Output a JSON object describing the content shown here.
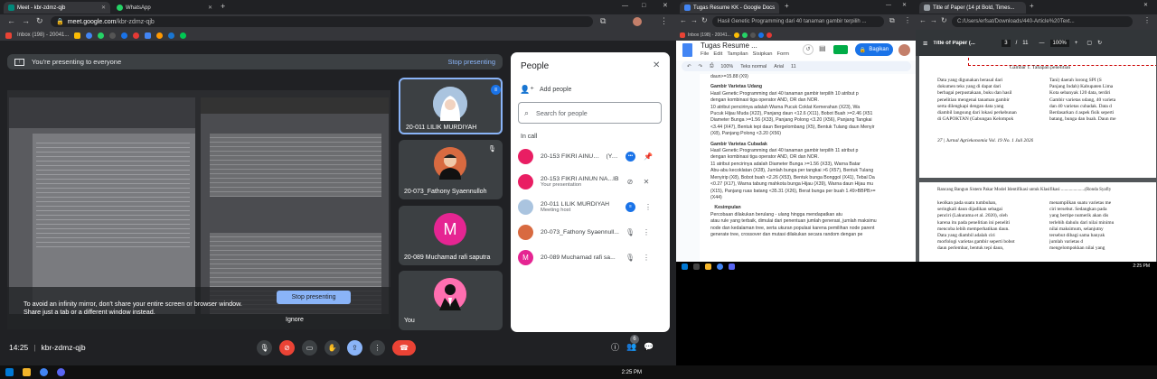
{
  "meet": {
    "tabs": [
      {
        "title": "Meet - kbr-zdmz-qjb"
      },
      {
        "title": "WhatsApp"
      }
    ],
    "url_host": "meet.google.com",
    "url_path": "/kbr-zdmz-qjb",
    "bookmark_inbox": "Inbox (198) - 20041...",
    "banner_text": "You're presenting to everyone",
    "stop_presenting": "Stop presenting",
    "mirror_warning_line1": "To avoid an infinity mirror, don't share your entire screen or browser window.",
    "mirror_warning_line2": "Share just a tab or a different window instead.",
    "mirror_stop_button": "Stop presenting",
    "mirror_ignore": "Ignore",
    "tiles": [
      {
        "name": "20-011 LILIK MURDIYAH"
      },
      {
        "name": "20-073_Fathony Syaennulloh"
      },
      {
        "name": "20-089 Muchamad rafi saputra",
        "initial": "M"
      },
      {
        "name": "You"
      }
    ],
    "meeting_time": "14:25",
    "meeting_code": "kbr-zdmz-qjb",
    "people_badge": "6",
    "people": {
      "title": "People",
      "add_people": "Add people",
      "search_placeholder": "Search for people",
      "in_call": "In call",
      "list": [
        {
          "name": "20-153 FIKRI AINUN ...",
          "tag": "(You)",
          "sub": ""
        },
        {
          "name": "20-153 FIKRI AINUN NA...IB",
          "tag": "",
          "sub": "Your presentation"
        },
        {
          "name": "20-011 LILIK MURDIYAH",
          "tag": "",
          "sub": "Meeting host"
        },
        {
          "name": "20-073_Fathony Syaennull...",
          "tag": "",
          "sub": ""
        },
        {
          "name": "20-089 Muchamad rafi sa...",
          "tag": "",
          "sub": ""
        }
      ],
      "initial_m": "M"
    }
  },
  "docs": {
    "tab_title": "Tugas Resume KK - Google Docs",
    "tab2": "Hasil Genetic Programming dari 40 tanaman gambir terpilih ...",
    "bookmark_inbox": "Inbox (198) - 20041...",
    "doc_title": "Tugas Resume ...",
    "menus": [
      "File",
      "Edit",
      "Tampilan",
      "Sisipkan",
      "Form"
    ],
    "share_label": "Bagikan",
    "zoom": "100%",
    "style": "Teks normal",
    "font": "Arial",
    "size": "11",
    "lines": [
      {
        "t": "daun>=15.88 (X9)",
        "c": "dt"
      },
      {
        "t": "Gambir Varietas Udang",
        "c": "dt dh"
      },
      {
        "t": "Hasil Genetic Programming dari 40 tanaman gambir terpilih 10 atribut p",
        "c": "dt"
      },
      {
        "t": "dengan kombinasi tiga operator AND, OR dan NOR.",
        "c": "dt"
      },
      {
        "t": "10 atribut pencirinya adalah Warna Pucuk Coklat Kemerahan (X23), Wa",
        "c": "dt"
      },
      {
        "t": "Pucuk Hijau Muda (X22), Panjang daun <12.6 (X11), Bobot Buah >=2.46 (X51",
        "c": "dt"
      },
      {
        "t": "Diameter Bunga >=1.56 (X33), Panjang Polong <3.20 (X56), Panjang Tangkai",
        "c": "dt"
      },
      {
        "t": "<3.44 (X47), Bentuk tepi daun Bergelombang (X5), Bentuk Tulang daun Menyir",
        "c": "dt"
      },
      {
        "t": "(X8), Panjang Polong <3.20 (X56)",
        "c": "dt"
      },
      {
        "t": "Gambir Varietas Cubadak",
        "c": "dt dh"
      },
      {
        "t": "Hasil Genetic Programming dari 40 tanaman gambir terpilih 11 atribut p",
        "c": "dt"
      },
      {
        "t": "dengan kombinasi tiga operator AND, OR dan NOR.",
        "c": "dt"
      },
      {
        "t": "11 atribut pencirinya adalah Diameter Bunga >=1.56 (X33), Warna Batar",
        "c": "dt"
      },
      {
        "t": "Abu-abu kecoklatan (X28), Jumlah bunga per tangkai >6 (X57), Bentuk Tulang",
        "c": "dt"
      },
      {
        "t": "Menyirip (X8), Bobot buah <2.26 (X53), Bentuk bunga Bonggol (X41), Tebal Da",
        "c": "dt"
      },
      {
        "t": "<0.27 (X17), Warna tabung mahkota bunga Hijau (X39), Warna daun Hijau mu",
        "c": "dt"
      },
      {
        "t": "(X15), Panjang ruas batang <35.31 (X26), Berat bunga per buah 1.49>BBPB>=",
        "c": "dt"
      },
      {
        "t": "(X44)",
        "c": "dt"
      }
    ],
    "section_num": "5.",
    "section_title": "Kesimpulan",
    "concl": [
      "Percobaan dilakukan berulang - ulang hingga mendapatkan atu",
      "atau rule yang terbaik, dimulai dari penentuan jumlah generasi, jumlah maksimu",
      "node dan kedalaman tree, serta ukuran populasi karena pemilihan node parent",
      "generate tree, crossover dan mutasi dilakukan secara random dengan pe"
    ]
  },
  "pdf": {
    "tab_title": "Title of Paper (14 pt Bold, Times...",
    "url": "C:/Users/erfsat/Downloads/440-Article%20Text...",
    "toolbar_title": "Title of Paper (...",
    "page_num": "3",
    "page_total": "11",
    "zoom": "100%",
    "figure_caption": "Gambar 1. Tahapan penelitian",
    "left_col": [
      "Data yang digunakan berasal dari",
      "dokumen teks yang di dapat dari",
      "berbagai perpustakaan, buku dan hasil",
      "penelitian mengenai tanaman gambir",
      "serta dilengkapi dengan data yang",
      "diambil langsung dari lokasi perkebunan",
      "di GAPOKTAN (Gabungan Kelompok"
    ],
    "right_col": [
      "Tani) daerah lorong SPI (S",
      "Panjang Indah) Kabupaten Lima",
      "Kota sebanyak 120 data, terdiri",
      "Gambir varietas udang, 40 varieta",
      "dan 40 varietas cubadak. Data d",
      "Berdasarkan 4 aspek fisik seperti",
      "batang, bunga dan buah. Daun me"
    ],
    "footer": "37 | Jurnal Agriekonomia Vol. 19 No. 1 Juli 2020",
    "header2": "Rancang Bangun Sistem Pakar Model Identifikasi untuk Klasifikasi .....................(Ronda Syafly",
    "left_col2": [
      "keolkan pada suatu tumbuhan,",
      "seringkali daun dijadikan sebagai",
      "penciri (Lakurama et al. 2020), oleh",
      "karena itu pada penelitian ini peneliti",
      "mencoba lebih memperhatikan daun.",
      "Data yang diambil adalah ciri",
      "morfologi varietas gambir seperti bobot",
      "daun perlembar, bentuk tepi daun,"
    ],
    "right_col2": [
      "menampilkan suatu varietas me",
      "ciri tersebut. Sedangkan pada",
      "yang bertipe numerik akan dis",
      "terlebih dahulu dari nilai minimu",
      "nilai maksimum, selanjutny",
      "tersebut dibagi sama banyak",
      "jumlah varietas d",
      "mengelompokkan nilai yang"
    ],
    "taskbar_time": "2:25 PM"
  },
  "taskbar": {
    "time": "2:25 PM"
  }
}
